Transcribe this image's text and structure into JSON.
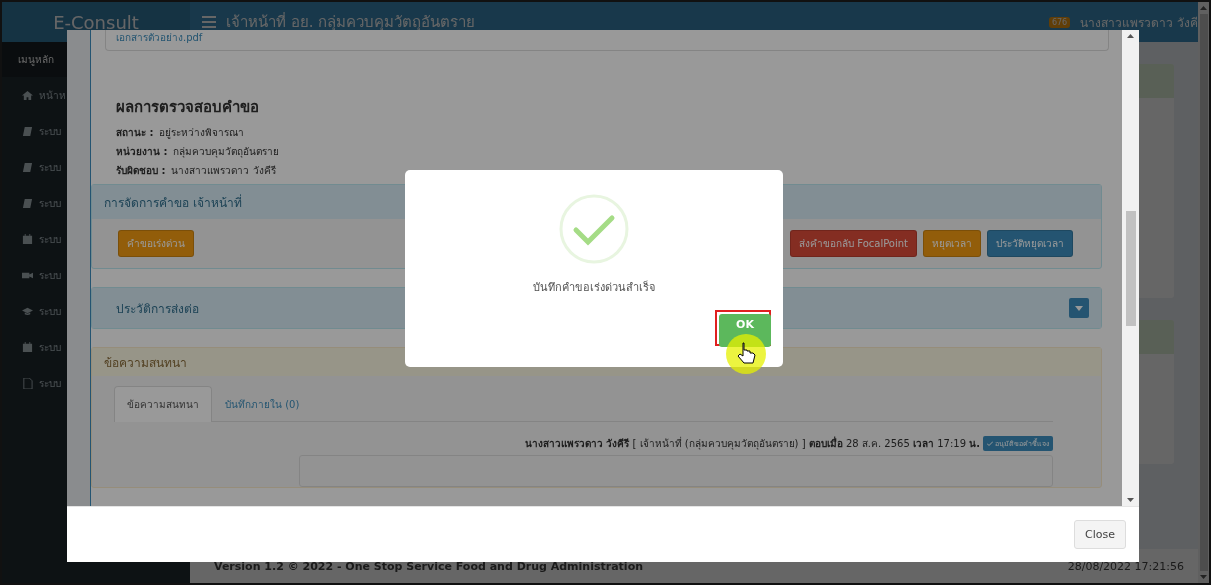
{
  "header": {
    "logo": "E-Consult",
    "title": "เจ้าหน้าที่ อย. กลุ่มควบคุมวัตถุอันตราย",
    "notification_count": "676",
    "user": "นางสาวแพรวดาว วังคี"
  },
  "sidebar": {
    "heading": "เมนูหลัก",
    "items": [
      {
        "label": "หน้าห",
        "kind": "home"
      },
      {
        "label": "ระบบ",
        "kind": "book"
      },
      {
        "label": "ระบบ",
        "kind": "book"
      },
      {
        "label": "ระบบ",
        "kind": "book"
      },
      {
        "label": "ระบบ",
        "kind": "calendar"
      },
      {
        "label": "ระบบ",
        "kind": "video"
      },
      {
        "label": "ระบบ",
        "kind": "cap"
      },
      {
        "label": "ระบบ",
        "kind": "calendar"
      },
      {
        "label": "ระบบ",
        "kind": "file"
      }
    ]
  },
  "footer": {
    "version": "Version 1.2 © 2022 - One Stop Service Food and Drug Administration",
    "timestamp": "28/08/2022 17:21:56"
  },
  "modal": {
    "file_link": "เอกสารตัวอย่าง.pdf",
    "result": {
      "title": "ผลการตรวจสอบคำขอ",
      "fields": [
        {
          "label": "สถานะ :",
          "value": "อยู่ระหว่างพิจารณา"
        },
        {
          "label": "หน่วยงาน :",
          "value": "กลุ่มควบคุมวัตถุอันตราย"
        },
        {
          "label": "รับผิดชอบ :",
          "value": "นางสาวแพรวดาว วังคีรี"
        }
      ]
    },
    "actions_panel": {
      "title": "การจัดการคำขอ เจ้าหน้าที่",
      "buttons": [
        {
          "label": "คำขอเร่งด่วน",
          "kind": "warning"
        },
        {
          "label": "ส่งคำขอกลับ FocalPoint",
          "kind": "danger"
        },
        {
          "label": "หยุดเวลา",
          "kind": "warning"
        },
        {
          "label": "ประวัติหยุดเวลา",
          "kind": "primary"
        }
      ]
    },
    "forward_panel": {
      "title": "ประวัติการส่งต่อ"
    },
    "chat_panel": {
      "title": "ข้อความสนทนา",
      "tabs": [
        {
          "label": "ข้อความสนทนา",
          "selected": true
        },
        {
          "label": "บันทึกภายใน (0)",
          "selected": false
        }
      ],
      "messages": [
        {
          "header": "**นางสาวแพรวดาว วังคีรี** [ เจ้าหน้าที่ (กลุ่มควบคุมวัตถุอันตราย) ] **ตอบเมื่อ** 28 ส.ค. 2565 **เวลา** 17:19 **น.**",
          "badge": "อนุมัติขอคำชี้แจง"
        }
      ]
    },
    "close_button": "Close"
  },
  "alert": {
    "message": "บันทึกคำขอเร่งด่วนสำเร็จ",
    "confirm": "OK"
  }
}
